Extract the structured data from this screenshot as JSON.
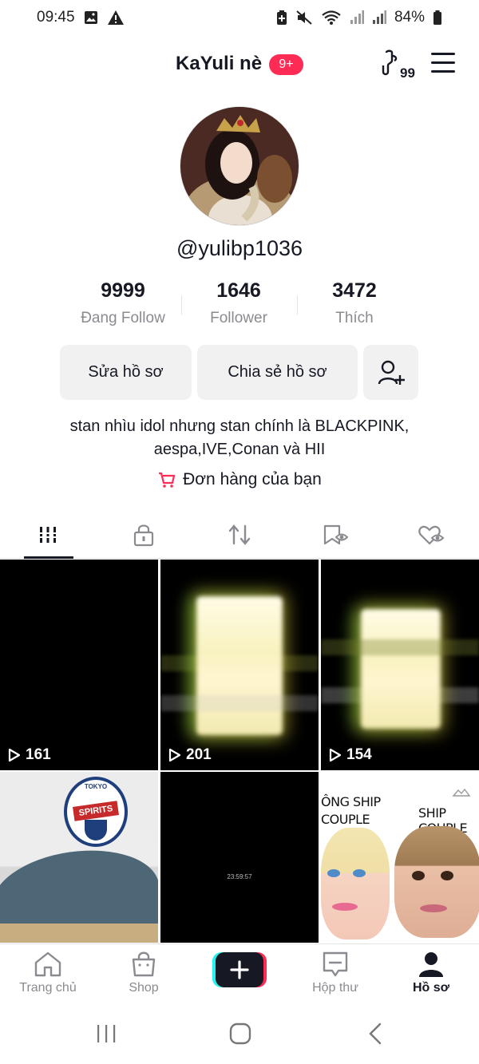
{
  "status_bar": {
    "time": "09:45",
    "battery": "84%",
    "icons": [
      "image-icon",
      "warning-icon",
      "battery-saver-icon",
      "mute-icon",
      "wifi-icon",
      "signal-icon",
      "signal-icon-2",
      "battery-icon"
    ]
  },
  "header": {
    "name": "KaYuli nè",
    "notifications_badge": "9+",
    "creator_count": "99"
  },
  "profile": {
    "username": "@yulibp1036",
    "stats": [
      {
        "value": "9999",
        "label": "Đang Follow"
      },
      {
        "value": "1646",
        "label": "Follower"
      },
      {
        "value": "3472",
        "label": "Thích"
      }
    ],
    "buttons": {
      "edit": "Sửa hồ sơ",
      "share": "Chia sẻ hồ sơ"
    },
    "bio_line1": "stan nhìu idol nhưng stan chính là BLACKPINK,",
    "bio_line2": "aespa,IVE,Conan và HII",
    "orders_label": "Đơn hàng của bạn"
  },
  "tabs": [
    "videos-grid-icon",
    "lock-icon",
    "repost-icon",
    "favorites-icon",
    "liked-icon"
  ],
  "videos": [
    {
      "views": "161"
    },
    {
      "views": "201"
    },
    {
      "views": "154"
    },
    {
      "views": ""
    },
    {
      "views": "",
      "overlay_text": "23:59:57"
    },
    {
      "views": "",
      "labels": [
        "ÔNG SHIP",
        "COUPLE",
        "SHIP COUPLE"
      ]
    }
  ],
  "anime_badge_text": "SPIRITS",
  "anime_badge_top": "TOKYO",
  "bottom_nav": {
    "home": "Trang chủ",
    "shop": "Shop",
    "inbox": "Hộp thư",
    "profile": "Hồ sơ"
  },
  "colors": {
    "accent": "#fe2c55",
    "text": "#161823",
    "muted": "#8a8b91",
    "button_bg": "#f1f1f2"
  }
}
